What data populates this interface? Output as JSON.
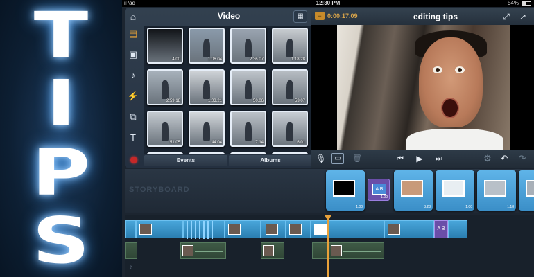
{
  "banner": {
    "letters": [
      "T",
      "I",
      "P",
      "S"
    ]
  },
  "status_bar": {
    "device": "iPad",
    "time": "12:30 PM",
    "battery": "54%"
  },
  "browser": {
    "title": "Video",
    "icons": [
      "home-icon",
      "grid-view-icon",
      "film-icon",
      "photo-icon",
      "music-note-icon",
      "lightning-icon",
      "transition-icon",
      "text-icon"
    ],
    "thumbnails": [
      {
        "duration": "4.00",
        "color": "#111418"
      },
      {
        "duration": "1:06.04",
        "color": "#8a9aaa"
      },
      {
        "duration": "2:36.07",
        "color": "#9aa4b0"
      },
      {
        "duration": "1:18.28",
        "color": "#c8ccd0"
      },
      {
        "duration": "2:59.18",
        "color": "#a8b2bc"
      },
      {
        "duration": "1:03.21",
        "color": "#d0d4d8"
      },
      {
        "duration": "50.06",
        "color": "#c0c6cc"
      },
      {
        "duration": "53.07",
        "color": "#b8bec4"
      },
      {
        "duration": "51.05",
        "color": "#c4cad0"
      },
      {
        "duration": "44.04",
        "color": "#d4d8dc"
      },
      {
        "duration": "7.14",
        "color": "#bcc2c8"
      },
      {
        "duration": "6.01",
        "color": "#c8ced4"
      }
    ],
    "tabs": [
      "Events",
      "Albums"
    ]
  },
  "viewer": {
    "timecode": "0:00:17.09",
    "project_title": "editing tips"
  },
  "storyboard": {
    "label": "STORYBOARD",
    "clips": [
      {
        "kind": "clip",
        "duration": "1.00",
        "color": "#000000"
      },
      {
        "kind": "transition",
        "label": "A B",
        "duration": "1.00"
      },
      {
        "kind": "clip",
        "duration": "3.28",
        "color": "#c89a7a"
      },
      {
        "kind": "clip",
        "duration": "1.00",
        "color": "#e8eef2"
      },
      {
        "kind": "clip",
        "duration": "1.18",
        "color": "#b8c0c8"
      },
      {
        "kind": "clip",
        "duration": "",
        "color": "#a8b0b8"
      }
    ]
  },
  "timeline": {
    "transition_label": "A B"
  }
}
